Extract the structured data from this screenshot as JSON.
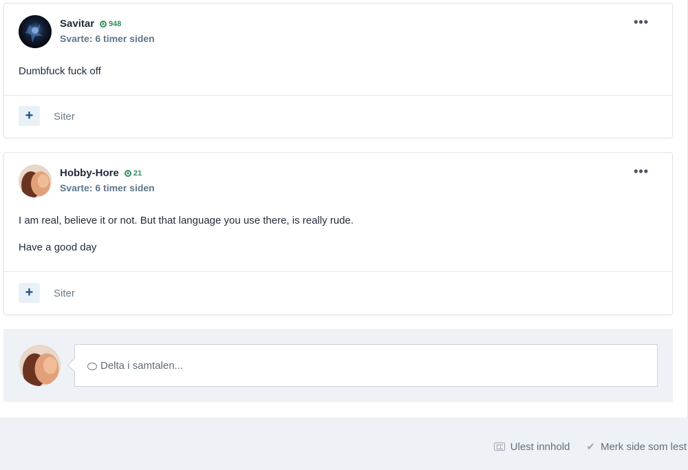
{
  "posts": [
    {
      "author": "Savitar",
      "reputation": "948",
      "meta": "Svarte: 6 timer siden",
      "paragraphs": [
        "Dumbfuck fuck off"
      ],
      "quote_label": "Siter",
      "menu": "•••"
    },
    {
      "author": "Hobby-Hore",
      "reputation": "21",
      "meta": "Svarte: 6 timer siden",
      "paragraphs": [
        "I am real, believe it or not. But that language you use there, is really rude.",
        "Have a good day"
      ],
      "quote_label": "Siter",
      "menu": "•••"
    }
  ],
  "reply": {
    "placeholder": "Delta i samtalen..."
  },
  "footer": {
    "unread": "Ulest innhold",
    "mark_read": "Merk side som lest"
  },
  "icons": {
    "quote": "+",
    "check": "✔"
  },
  "colors": {
    "reputation": "#2f8f5b",
    "accent": "#1d4f80",
    "footer_bg": "#eef1f5"
  }
}
